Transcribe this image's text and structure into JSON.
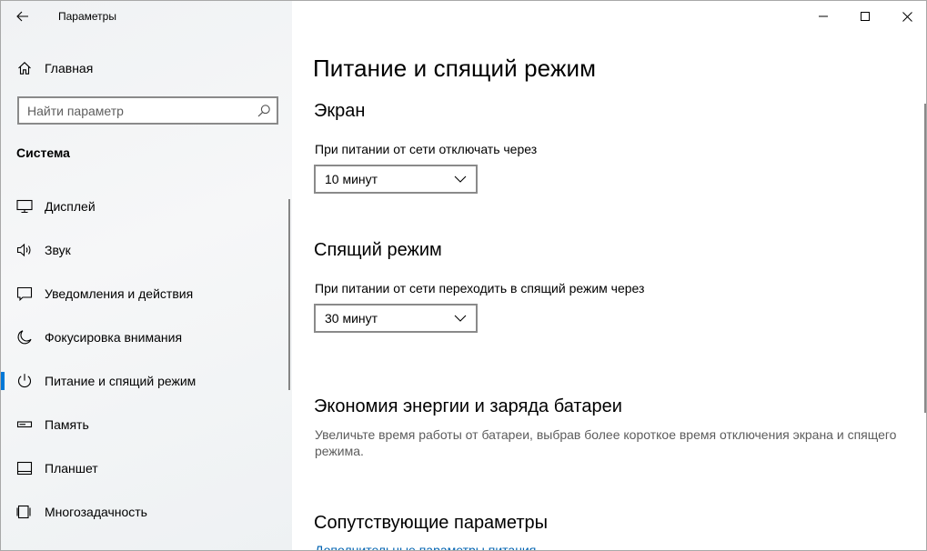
{
  "window": {
    "title": "Параметры",
    "controls": {
      "minimize": "minimize-icon",
      "maximize": "maximize-icon",
      "close": "close-icon"
    }
  },
  "sidebar": {
    "home_label": "Главная",
    "search_placeholder": "Найти параметр",
    "section_title": "Система",
    "items": [
      {
        "label": "Дисплей",
        "icon": "display-icon"
      },
      {
        "label": "Звук",
        "icon": "sound-icon"
      },
      {
        "label": "Уведомления и действия",
        "icon": "notifications-icon"
      },
      {
        "label": "Фокусировка внимания",
        "icon": "focus-assist-icon"
      },
      {
        "label": "Питание и спящий режим",
        "icon": "power-icon",
        "active": true
      },
      {
        "label": "Память",
        "icon": "storage-icon"
      },
      {
        "label": "Планшет",
        "icon": "tablet-icon"
      },
      {
        "label": "Многозадачность",
        "icon": "multitasking-icon"
      }
    ]
  },
  "main": {
    "page_title": "Питание и спящий режим",
    "screen": {
      "title": "Экран",
      "label": "При питании от сети отключать через",
      "value": "10 минут"
    },
    "sleep": {
      "title": "Спящий режим",
      "label": "При питании от сети переходить в спящий режим через",
      "value": "30 минут"
    },
    "energy": {
      "title": "Экономия энергии и заряда батареи",
      "description": "Увеличьте время работы от батареи, выбрав более короткое время отключения экрана и спящего режима."
    },
    "related": {
      "title": "Сопутствующие параметры",
      "link": "Дополнительные параметры питания"
    }
  },
  "colors": {
    "accent": "#0078d7",
    "link": "#0063b1"
  }
}
